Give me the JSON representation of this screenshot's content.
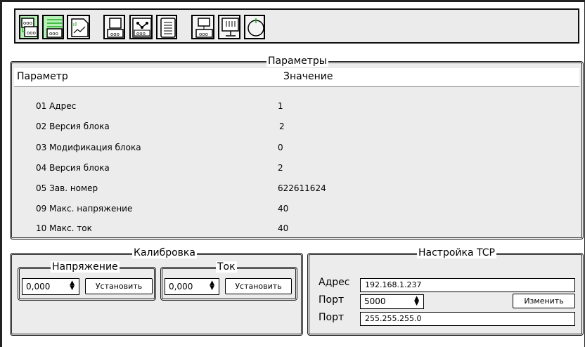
{
  "toolbar": {
    "buttons": [
      {
        "icon": "double-module-icon"
      },
      {
        "icon": "list-module-icon"
      },
      {
        "icon": "chart-window-icon"
      },
      {
        "icon": "box-module-icon"
      },
      {
        "icon": "network-module-icon"
      },
      {
        "icon": "document-list-icon"
      },
      {
        "icon": "computer-module-icon"
      },
      {
        "icon": "monitor-icon"
      },
      {
        "icon": "power-icon"
      }
    ]
  },
  "params": {
    "title": "Параметры",
    "col_param": "Параметр",
    "col_value": "Значение",
    "rows": [
      {
        "name": "01 Адрес",
        "value": "1"
      },
      {
        "name": "02 Версия блока",
        "value": "2"
      },
      {
        "name": "03 Модификация блока",
        "value": "0"
      },
      {
        "name": "04 Версия блока",
        "value": "2"
      },
      {
        "name": "05 Зав. номер",
        "value": "622611624"
      },
      {
        "name": "09 Макс. напряжение",
        "value": "40"
      },
      {
        "name": "10 Макс. ток",
        "value": "40"
      }
    ]
  },
  "calibration": {
    "title": "Калибровка",
    "voltage": {
      "title": "Напряжение",
      "value": "0,000",
      "button": "Установить"
    },
    "current": {
      "title": "Ток",
      "value": "0,000",
      "button": "Установить"
    }
  },
  "tcp": {
    "title": "Настройка TCP",
    "address_label": "Адрес",
    "address_value": "192.168.1.237",
    "port_label": "Порт",
    "port_value": "5000",
    "change_button": "Изменить",
    "mask_label": "Порт",
    "mask_value": "255.255.255.0"
  },
  "colors": {
    "active_button": "#b6f0b6",
    "accent_green": "#22aa22"
  }
}
